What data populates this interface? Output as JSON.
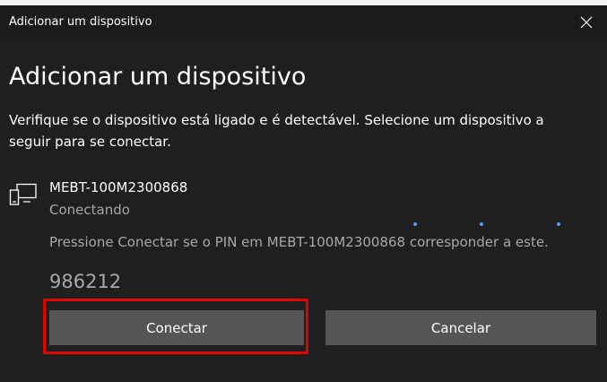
{
  "window": {
    "title": "Adicionar um dispositivo",
    "close_label": "✕"
  },
  "heading": "Adicionar um dispositivo",
  "description": "Verifique se o dispositivo está ligado e é detectável. Selecione um dispositivo a seguir para se conectar.",
  "device": {
    "icon": "device-display-icon",
    "name": "MEBT-100M2300868",
    "status": "Conectando",
    "pin_message": "Pressione Conectar se o PIN em MEBT-100M2300868 corresponder a este.",
    "pin": "986212"
  },
  "buttons": {
    "connect_label": "Conectar",
    "cancel_label": "Cancelar"
  },
  "colors": {
    "background": "#1f1f1f",
    "button": "#555555",
    "secondary_text": "#a8a8a8",
    "progress_dots": "#4ca0ff",
    "highlight": "#e00000"
  }
}
